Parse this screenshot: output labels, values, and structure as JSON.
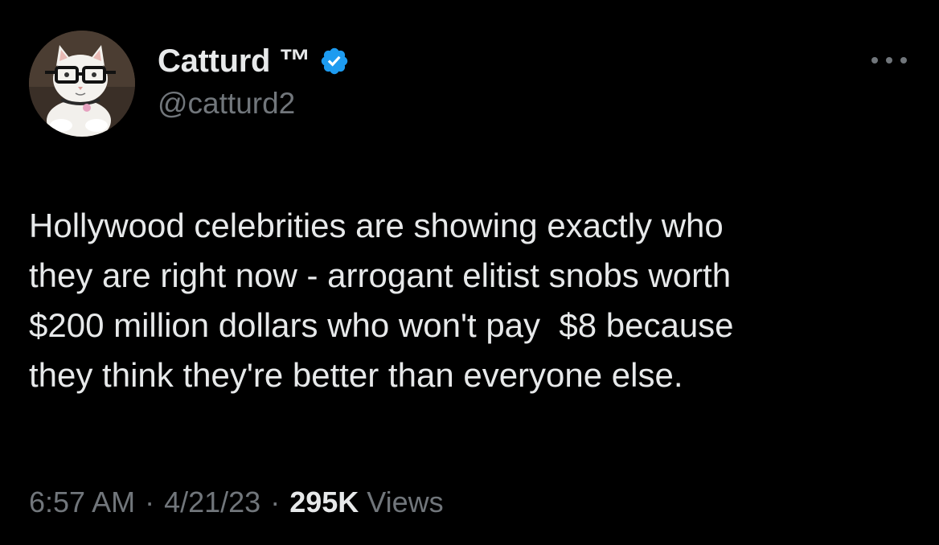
{
  "author": {
    "display_name": "Catturd ™",
    "handle": "@catturd2",
    "verified": true,
    "avatar_icon": "cat-with-glasses-avatar"
  },
  "menu": {
    "icon": "more-horizontal-icon"
  },
  "tweet": {
    "text": "Hollywood celebrities are showing exactly who\nthey are right now - arrogant elitist snobs worth\n$200 million dollars who won't pay  $8 because\nthey think they're better than everyone else."
  },
  "meta": {
    "time": "6:57 AM",
    "date": "4/21/23",
    "separator": "·",
    "views_count": "295K",
    "views_label": "Views"
  },
  "colors": {
    "background": "#000000",
    "primary_text": "#e7e9ea",
    "secondary_text": "#71767b",
    "verified_blue": "#1d9bf0"
  }
}
